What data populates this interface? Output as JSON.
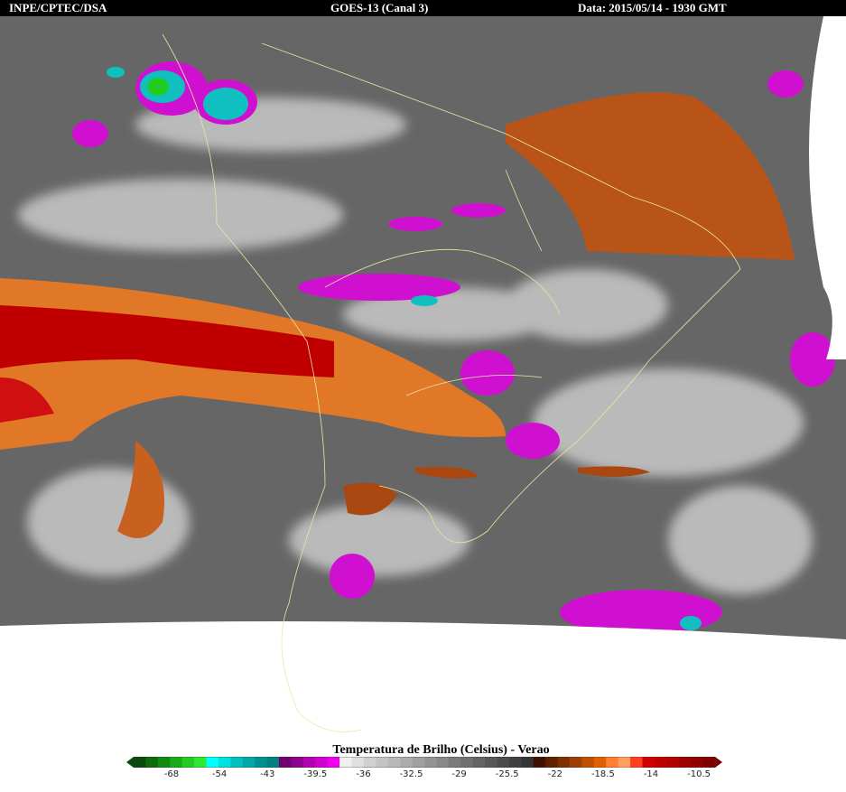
{
  "header": {
    "left": "INPE/CPTEC/DSA",
    "center": "GOES-13 (Canal 3)",
    "right": "Data: 2015/05/14 - 1930 GMT"
  },
  "legend": {
    "title": "Temperatura de Brilho (Celsius) - Verao",
    "ticks": [
      "-68",
      "-54",
      "-43",
      "-39.5",
      "-36",
      "-32.5",
      "-29",
      "-25.5",
      "-22",
      "-18.5",
      "-14",
      "-10.5"
    ],
    "colors": [
      "#0a4a0a",
      "#0d6a0d",
      "#108a10",
      "#18aa18",
      "#22cc22",
      "#30e830",
      "#00ffff",
      "#00e0e0",
      "#00c0c0",
      "#00a8a8",
      "#009090",
      "#008080",
      "#700070",
      "#900090",
      "#b000b0",
      "#d000d0",
      "#ee00ee",
      "#f0f0f0",
      "#e0e0e0",
      "#d0d0d0",
      "#c4c4c4",
      "#b8b8b8",
      "#acacac",
      "#a0a0a0",
      "#949494",
      "#888888",
      "#7c7c7c",
      "#707070",
      "#646464",
      "#585858",
      "#4c4c4c",
      "#404040",
      "#343434",
      "#401000",
      "#602000",
      "#803000",
      "#a04000",
      "#c05000",
      "#e06000",
      "#ff8030",
      "#ffa060",
      "#ff4020",
      "#d00000",
      "#c00000",
      "#b00000",
      "#a00000",
      "#900000",
      "#800000"
    ]
  },
  "map_colors": {
    "background": "#6a6a6a",
    "cloud": "#d8d8d8",
    "orange": "#c86020",
    "red": "#c00000",
    "magenta": "#d010d0",
    "cyan": "#10c0c0",
    "coast": "#e8e8a0"
  }
}
